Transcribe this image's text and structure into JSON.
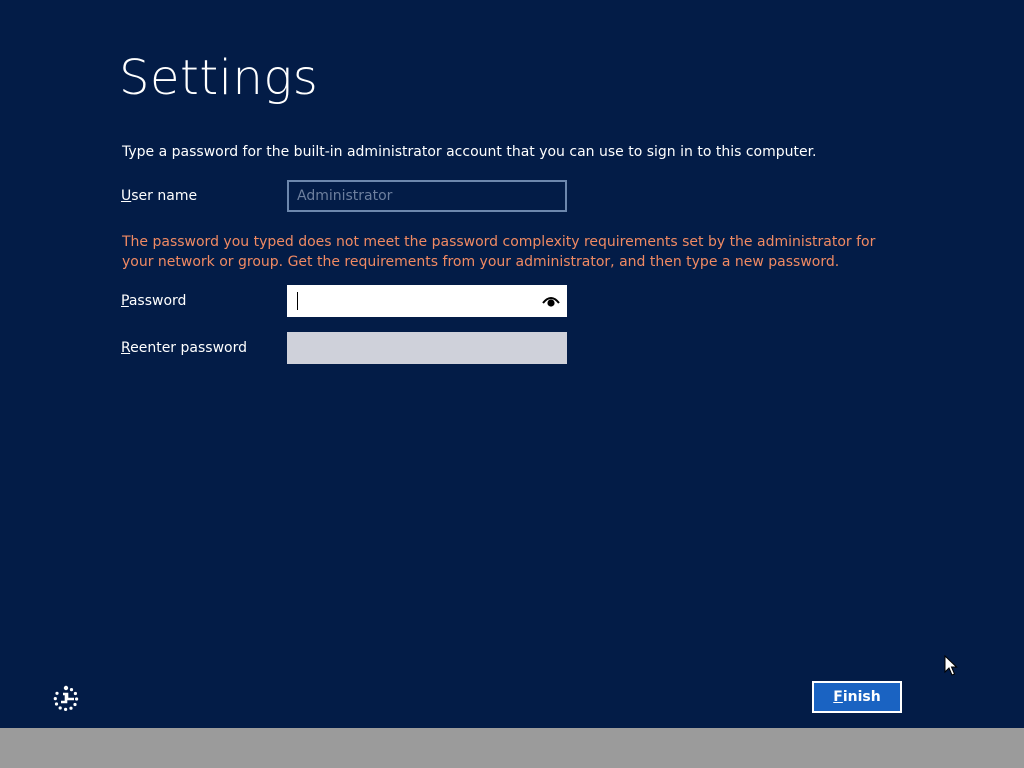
{
  "page": {
    "title": "Settings",
    "instruction": "Type a password for the built-in administrator account that you can use to sign in to this computer."
  },
  "form": {
    "username": {
      "label_accesskey": "U",
      "label_rest": "ser name",
      "value": "Administrator"
    },
    "error_message": "The password you typed does not meet the password complexity requirements set by the administrator for your network or group. Get the requirements from your administrator, and then type a new password.",
    "password": {
      "label_accesskey": "P",
      "label_rest": "assword",
      "value": ""
    },
    "reenter_password": {
      "label_accesskey": "R",
      "label_rest": "eenter password",
      "value": ""
    }
  },
  "footer": {
    "finish_accesskey": "F",
    "finish_rest": "inish",
    "ease_of_access_icon": "ease-of-access-icon"
  },
  "colors": {
    "background": "#031c47",
    "error": "#f08a63",
    "button": "#1a63c2",
    "taskbar": "#9b9b9b"
  }
}
